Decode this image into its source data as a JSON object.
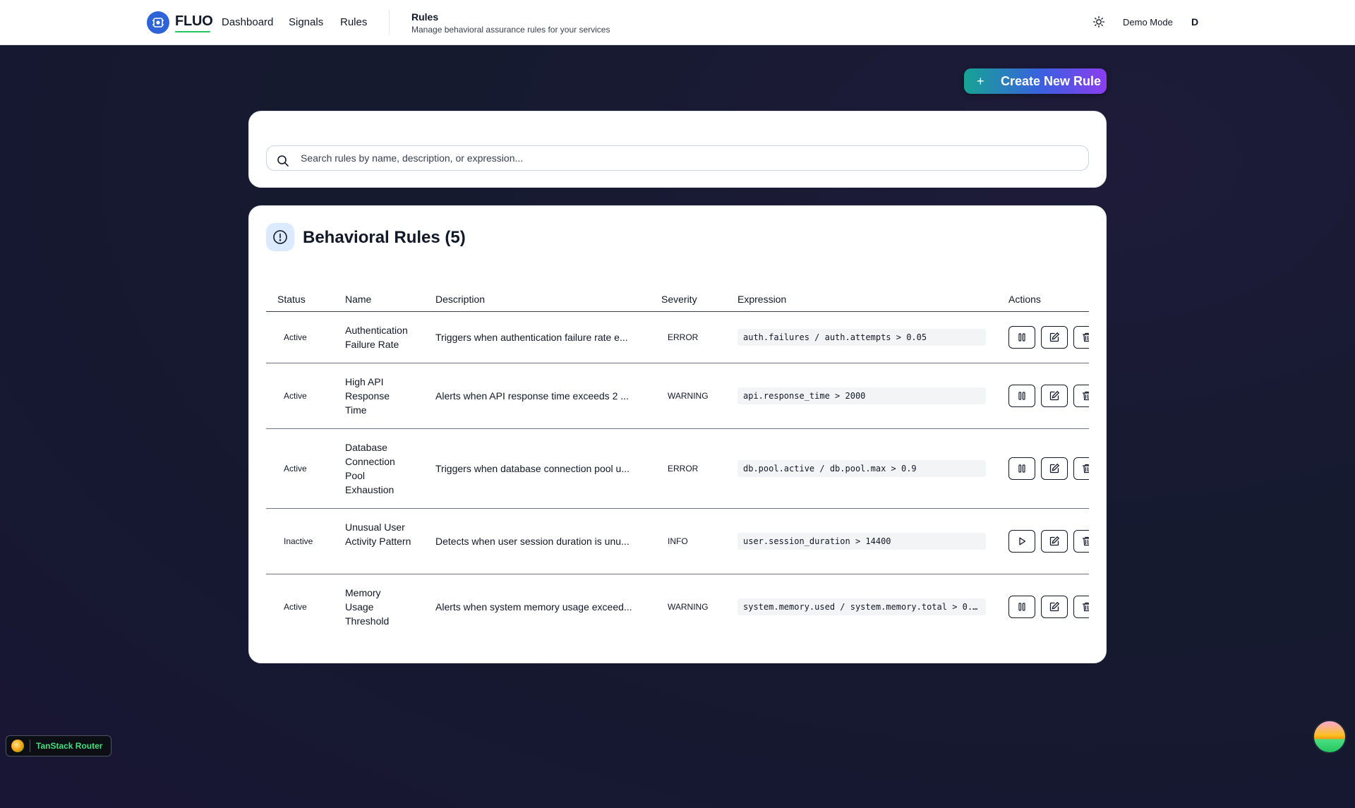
{
  "header": {
    "brand": "FLUO",
    "nav": [
      "Dashboard",
      "Signals",
      "Rules"
    ],
    "page_title": "Rules",
    "page_subtitle": "Manage behavioral assurance rules for your services",
    "demo_mode": "Demo Mode",
    "user_initial": "D"
  },
  "actions": {
    "create_label": "Create New Rule",
    "create_icon": "+"
  },
  "search": {
    "placeholder": "Search rules by name, description, or expression...",
    "value": ""
  },
  "rules": {
    "title": "Behavioral Rules (5)",
    "columns": [
      "Status",
      "Name",
      "Description",
      "Severity",
      "Expression",
      "Actions"
    ],
    "rows": [
      {
        "status": "Active",
        "name": "Authentication Failure Rate",
        "description": "Triggers when authentication failure rate e...",
        "severity": "ERROR",
        "expression": "auth.failures / auth.attempts > 0.05",
        "toggle_icon": "pause-icon"
      },
      {
        "status": "Active",
        "name": "High API Response Time",
        "description": "Alerts when API response time exceeds 2 ...",
        "severity": "WARNING",
        "expression": "api.response_time > 2000",
        "toggle_icon": "pause-icon"
      },
      {
        "status": "Active",
        "name": "Database Connection Pool Exhaustion",
        "description": "Triggers when database connection pool u...",
        "severity": "ERROR",
        "expression": "db.pool.active / db.pool.max > 0.9",
        "toggle_icon": "pause-icon"
      },
      {
        "status": "Inactive",
        "name": "Unusual User Activity Pattern",
        "description": "Detects when user session duration is unu...",
        "severity": "INFO",
        "expression": "user.session_duration > 14400",
        "toggle_icon": "play-icon"
      },
      {
        "status": "Active",
        "name": "Memory Usage Threshold",
        "description": "Alerts when system memory usage exceed...",
        "severity": "WARNING",
        "expression": "system.memory.used / system.memory.total > 0.…",
        "toggle_icon": "pause-icon"
      }
    ]
  },
  "devtools": {
    "label": "TanStack Router"
  },
  "colors": {
    "brand": "#2f63d8",
    "accent_underline": "#22c55e",
    "gradient_start": "#16a394",
    "gradient_end": "#8b3df0"
  }
}
